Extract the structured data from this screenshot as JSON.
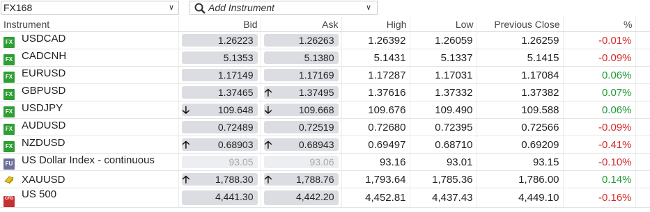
{
  "list_selector": {
    "value": "FX168",
    "icon": "chevron-down-icon"
  },
  "add_instrument": {
    "placeholder": "Add Instrument",
    "icon": "search-icon"
  },
  "columns": [
    "Instrument",
    "Bid",
    "Ask",
    "High",
    "Low",
    "Previous Close",
    "%"
  ],
  "colors": {
    "negative": "#d62a2a",
    "positive": "#1f9a35",
    "fx_badge": "#2e9e35",
    "pill": "#dcdde2"
  },
  "rows": [
    {
      "badge": "FX",
      "name": "USDCAD",
      "bid": "1.26223",
      "ask": "1.26263",
      "high": "1.26392",
      "low": "1.26059",
      "prev": "1.26259",
      "pct": "-0.01%",
      "bid_arrow": "",
      "ask_arrow": ""
    },
    {
      "badge": "FX",
      "name": "CADCNH",
      "bid": "5.1353",
      "ask": "5.1380",
      "high": "5.1431",
      "low": "5.1337",
      "prev": "5.1415",
      "pct": "-0.09%",
      "bid_arrow": "",
      "ask_arrow": ""
    },
    {
      "badge": "FX",
      "name": "EURUSD",
      "bid": "1.17149",
      "ask": "1.17169",
      "high": "1.17287",
      "low": "1.17031",
      "prev": "1.17084",
      "pct": "0.06%",
      "bid_arrow": "",
      "ask_arrow": ""
    },
    {
      "badge": "FX",
      "name": "GBPUSD",
      "bid": "1.37465",
      "ask": "1.37495",
      "high": "1.37616",
      "low": "1.37332",
      "prev": "1.37382",
      "pct": "0.07%",
      "bid_arrow": "",
      "ask_arrow": "up"
    },
    {
      "badge": "FX",
      "name": "USDJPY",
      "bid": "109.648",
      "ask": "109.668",
      "high": "109.676",
      "low": "109.490",
      "prev": "109.588",
      "pct": "0.06%",
      "bid_arrow": "down",
      "ask_arrow": "down"
    },
    {
      "badge": "FX",
      "name": "AUDUSD",
      "bid": "0.72489",
      "ask": "0.72519",
      "high": "0.72680",
      "low": "0.72395",
      "prev": "0.72566",
      "pct": "-0.09%",
      "bid_arrow": "",
      "ask_arrow": ""
    },
    {
      "badge": "FX",
      "name": "NZDUSD",
      "bid": "0.68903",
      "ask": "0.68943",
      "high": "0.69497",
      "low": "0.68710",
      "prev": "0.69209",
      "pct": "-0.41%",
      "bid_arrow": "up",
      "ask_arrow": "up"
    },
    {
      "badge": "FU",
      "name": "US Dollar Index - continuous",
      "bid": "93.05",
      "ask": "93.06",
      "high": "93.16",
      "low": "93.01",
      "prev": "93.15",
      "pct": "-0.10%",
      "bid_arrow": "",
      "ask_arrow": "",
      "faded": true
    },
    {
      "badge": "GOLD",
      "name": "XAUUSD",
      "bid": "1,788.30",
      "ask": "1,788.76",
      "high": "1,793.64",
      "low": "1,785.36",
      "prev": "1,786.00",
      "pct": "0.14%",
      "bid_arrow": "up",
      "ask_arrow": "up"
    },
    {
      "badge": "CFD",
      "name": "US 500",
      "bid": "4,441.30",
      "ask": "4,442.20",
      "high": "4,452.81",
      "low": "4,437.43",
      "prev": "4,449.10",
      "pct": "-0.16%",
      "bid_arrow": "",
      "ask_arrow": ""
    }
  ]
}
